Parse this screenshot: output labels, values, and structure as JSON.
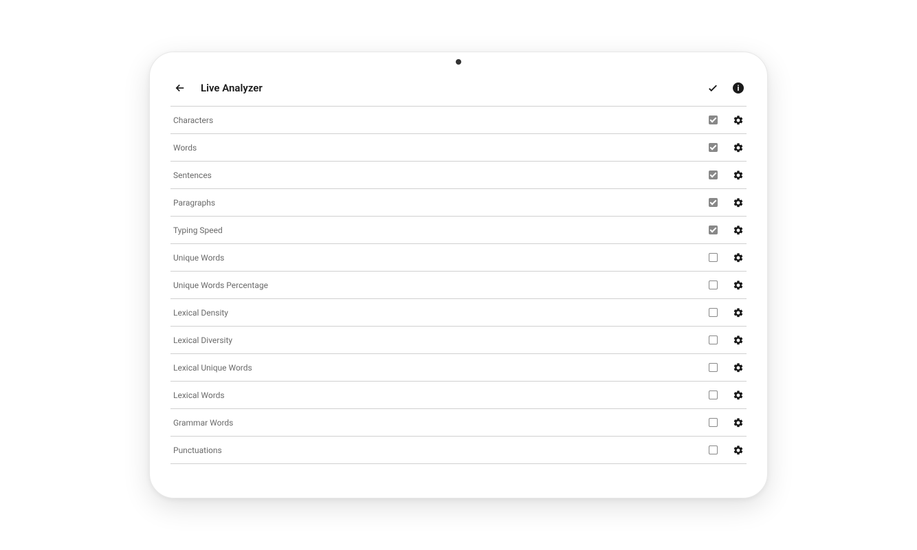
{
  "header": {
    "title": "Live Analyzer"
  },
  "items": [
    {
      "label": "Characters",
      "checked": true
    },
    {
      "label": "Words",
      "checked": true
    },
    {
      "label": "Sentences",
      "checked": true
    },
    {
      "label": "Paragraphs",
      "checked": true
    },
    {
      "label": "Typing Speed",
      "checked": true
    },
    {
      "label": "Unique Words",
      "checked": false
    },
    {
      "label": "Unique Words Percentage",
      "checked": false
    },
    {
      "label": "Lexical Density",
      "checked": false
    },
    {
      "label": "Lexical Diversity",
      "checked": false
    },
    {
      "label": "Lexical Unique Words",
      "checked": false
    },
    {
      "label": "Lexical Words",
      "checked": false
    },
    {
      "label": "Grammar Words",
      "checked": false
    },
    {
      "label": "Punctuations",
      "checked": false
    }
  ]
}
